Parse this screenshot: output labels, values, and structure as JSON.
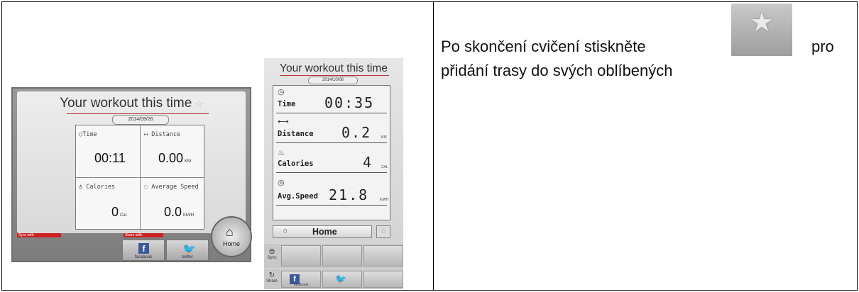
{
  "landscape": {
    "title": "Your workout this time",
    "star": "☆",
    "date": "2014/09/26",
    "cells": [
      {
        "label": "○Time",
        "value": "00:11",
        "unit": ""
      },
      {
        "label": "⟷ Distance",
        "value": "0.00",
        "unit": "KM"
      },
      {
        "label": "♁ Calories",
        "value": "0",
        "unit": "Cal"
      },
      {
        "label": "◌ Average Speed",
        "value": "0.0",
        "unit": "KM/H"
      }
    ],
    "sync_tag": "Sync with:",
    "share_tag": "Share with:",
    "facebook": "facebook",
    "twitter": "twitter",
    "home": "Home"
  },
  "portrait": {
    "title": "Your workout this time",
    "date": "2014/10/06",
    "rows": [
      {
        "icon": "◷",
        "label": "Time",
        "value": "00:35",
        "unit": ""
      },
      {
        "icon": "⟷",
        "label": "Distance",
        "value": "0.2",
        "unit": "KM"
      },
      {
        "icon": "♨",
        "label": "Calories",
        "value": "4",
        "unit": "CAL"
      },
      {
        "icon": "◎",
        "label": "Avg.Speed",
        "value": "21.8",
        "unit": "KM/H"
      }
    ],
    "home": "Home",
    "sync": "Sync",
    "share": "Share",
    "facebook": "facebook"
  },
  "instruction": {
    "line1": "Po skončení cvičení  stiskněte",
    "after_icon": "pro",
    "line2": "přidání trasy do svých oblíbených",
    "icon": "star-icon"
  }
}
